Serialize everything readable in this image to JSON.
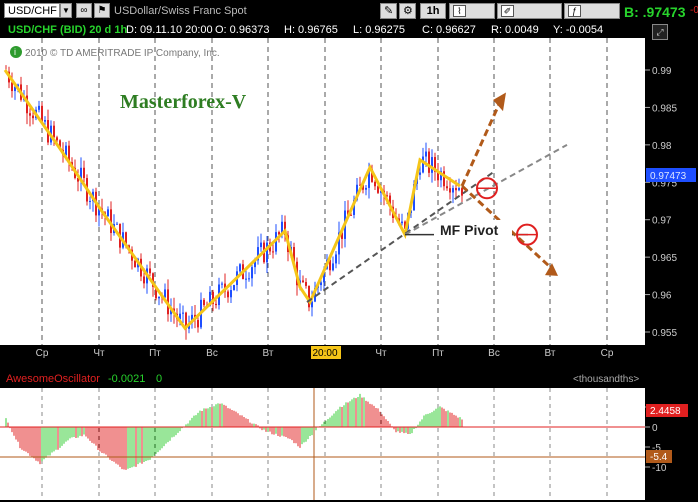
{
  "toolbar": {
    "symbol": "USD/CHF",
    "description": "USDollar/Swiss Franc Spot",
    "timeframe": "1h",
    "style_label": "Style",
    "drawings_label": "Drawings",
    "studies_label": "Studies",
    "bid_label": "B:",
    "bid_value": ".97473",
    "bid_change": "-0"
  },
  "info_bar": {
    "title": "USD/CHF (BID) 20 d 1h",
    "date": "D: 09.11.10 20:00",
    "open": "O: 0.96373",
    "high": "H: 0.96765",
    "low": "L: 0.96275",
    "close": "C: 0.96627",
    "range": "R: 0.0049",
    "y": "Y: -0.0054"
  },
  "copyright": "2010 © TD AMERITRADE IP Company, Inc.",
  "annotations": {
    "watermark": "Masterforex-V",
    "pivot_label": "MF Pivot"
  },
  "price_axis": {
    "ticks": [
      "0.99",
      "0.985",
      "0.98",
      "0.975",
      "0.97",
      "0.965",
      "0.96",
      "0.955"
    ],
    "current_price": "0.97473"
  },
  "time_axis": {
    "labels": [
      "Ср",
      "Чт",
      "Пт",
      "Вс",
      "Вт",
      "20:00",
      "Чт",
      "Пт",
      "Вс",
      "Вт",
      "Ср"
    ],
    "highlight": "20:00"
  },
  "oscillator": {
    "name": "AwesomeOscillator",
    "value": "-0.0021",
    "zero": "0",
    "units": "<thousandths>",
    "ticks": [
      "5",
      "0",
      "-5",
      "-10"
    ],
    "current_value": "2.4458",
    "crosshair_value": "-5.4"
  },
  "colors": {
    "bull": "#1e4fff",
    "bear": "#e02020",
    "zigzag": "#f5c518",
    "trend": "#b8b8b8",
    "projection": "#b15a1a",
    "osc_up": "#33cc33",
    "osc_down": "#e02020",
    "accent_green": "#27d32c",
    "watermark": "#2e7d22"
  },
  "icons": {
    "symbol_dropdown": "chevron-down-icon",
    "link": "link-icon",
    "flag": "flag-icon",
    "checkbox": "checkbox-icon",
    "settings": "gear-icon",
    "tools": "tools-icon",
    "style": "style-icon",
    "drawings": "drawings-icon",
    "studies": "studies-icon",
    "info": "info-icon",
    "expand": "expand-icon"
  }
}
